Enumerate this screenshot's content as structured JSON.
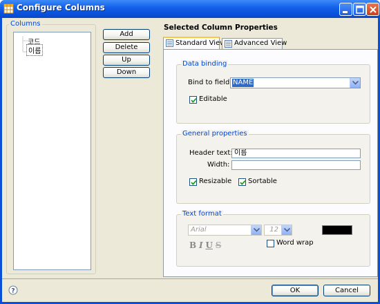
{
  "window": {
    "title": "Configure Columns",
    "buttons": [
      "minimize",
      "maximize",
      "close"
    ]
  },
  "columns": {
    "legend": "Columns",
    "items": [
      "코드",
      "이름"
    ],
    "selected_index": 1
  },
  "actions": {
    "add": "Add",
    "delete": "Delete",
    "up": "Up",
    "down": "Down"
  },
  "properties": {
    "heading": "Selected Column Properties",
    "tabs": [
      {
        "label": "Standard View",
        "active": true
      },
      {
        "label": "Advanced View",
        "active": false
      }
    ],
    "data_binding": {
      "legend": "Data binding",
      "bind_label": "Bind to field:",
      "bind_value": "NAME",
      "editable_label": "Editable",
      "editable_checked": true
    },
    "general": {
      "legend": "General properties",
      "header_label": "Header text:",
      "header_value": "이름",
      "width_label": "Width:",
      "width_value": "",
      "resizable_label": "Resizable",
      "resizable_checked": true,
      "sortable_label": "Sortable",
      "sortable_checked": true
    },
    "text_format": {
      "legend": "Text format",
      "font_value": "Arial",
      "size_value": "12",
      "color": "#000000",
      "style_buttons": [
        "B",
        "I",
        "U",
        "S"
      ],
      "word_wrap_label": "Word wrap",
      "word_wrap_checked": false
    }
  },
  "footer": {
    "ok": "OK",
    "cancel": "Cancel",
    "help_icon": "help-icon"
  },
  "colors": {
    "titlebar": "#0a4fd8",
    "dialog_bg": "#ece9d8",
    "legend_text": "#0046d5",
    "selection": "#316ac5"
  }
}
